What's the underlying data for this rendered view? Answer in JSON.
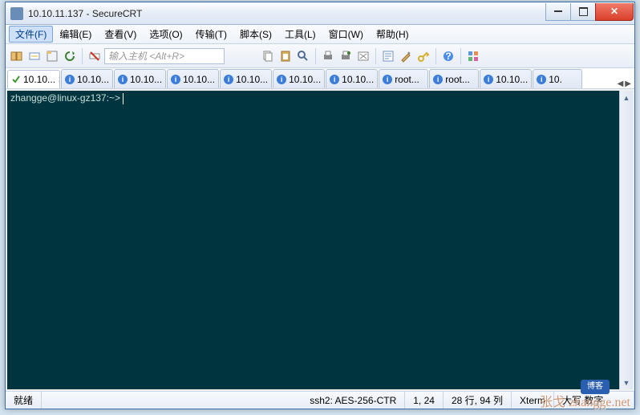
{
  "window": {
    "title": "10.10.11.137 - SecureCRT"
  },
  "menu": {
    "items": [
      {
        "label": "文件(F)",
        "active": true
      },
      {
        "label": "编辑(E)"
      },
      {
        "label": "查看(V)"
      },
      {
        "label": "选项(O)"
      },
      {
        "label": "传输(T)"
      },
      {
        "label": "脚本(S)"
      },
      {
        "label": "工具(L)"
      },
      {
        "label": "窗口(W)"
      },
      {
        "label": "帮助(H)"
      }
    ]
  },
  "toolbar": {
    "host_placeholder": "输入主机 <Alt+R>"
  },
  "tabs": {
    "items": [
      {
        "label": "10.10...",
        "icon": "check",
        "active": true,
        "closable": true
      },
      {
        "label": "10.10...",
        "icon": "info"
      },
      {
        "label": "10.10...",
        "icon": "info"
      },
      {
        "label": "10.10...",
        "icon": "info"
      },
      {
        "label": "10.10...",
        "icon": "info"
      },
      {
        "label": "10.10...",
        "icon": "info"
      },
      {
        "label": "10.10...",
        "icon": "info"
      },
      {
        "label": "root...",
        "icon": "info"
      },
      {
        "label": "root...",
        "icon": "info"
      },
      {
        "label": "10.10...",
        "icon": "info"
      },
      {
        "label": "10.",
        "icon": "info"
      }
    ]
  },
  "terminal": {
    "prompt": "zhangge@linux-gz137:~> "
  },
  "status": {
    "ready": "就绪",
    "proto": "ssh2: AES-256-CTR",
    "pos": "1, 24",
    "dim": "28 行, 94 列",
    "term": "Xterm",
    "caps": "大写 数字"
  },
  "watermark": {
    "badge": "博客",
    "text": "张戈 zhangge.net"
  }
}
